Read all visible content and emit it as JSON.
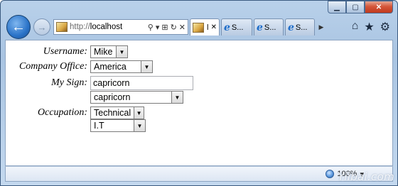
{
  "browser": {
    "address": {
      "protocol": "http://",
      "host": "localhost"
    },
    "tabs": [
      {
        "label": "l",
        "icon": "page-favicon",
        "active": true
      },
      {
        "label": "S...",
        "icon": "ie-e-icon",
        "active": false
      },
      {
        "label": "S...",
        "icon": "ie-e-icon",
        "active": false
      },
      {
        "label": "S...",
        "icon": "ie-e-icon",
        "active": false
      }
    ],
    "status": {
      "zoom": "100%"
    }
  },
  "form": {
    "username": {
      "label": "Username:",
      "value": "Mike"
    },
    "office": {
      "label": "Company Office:",
      "value": "America"
    },
    "sign": {
      "label": "My Sign:",
      "text_value": "capricorn",
      "select_value": "capricorn"
    },
    "occupation": {
      "label": "Occupation:",
      "value": "Technical",
      "sub_value": "I.T"
    }
  },
  "watermark": "Yiibai.com"
}
